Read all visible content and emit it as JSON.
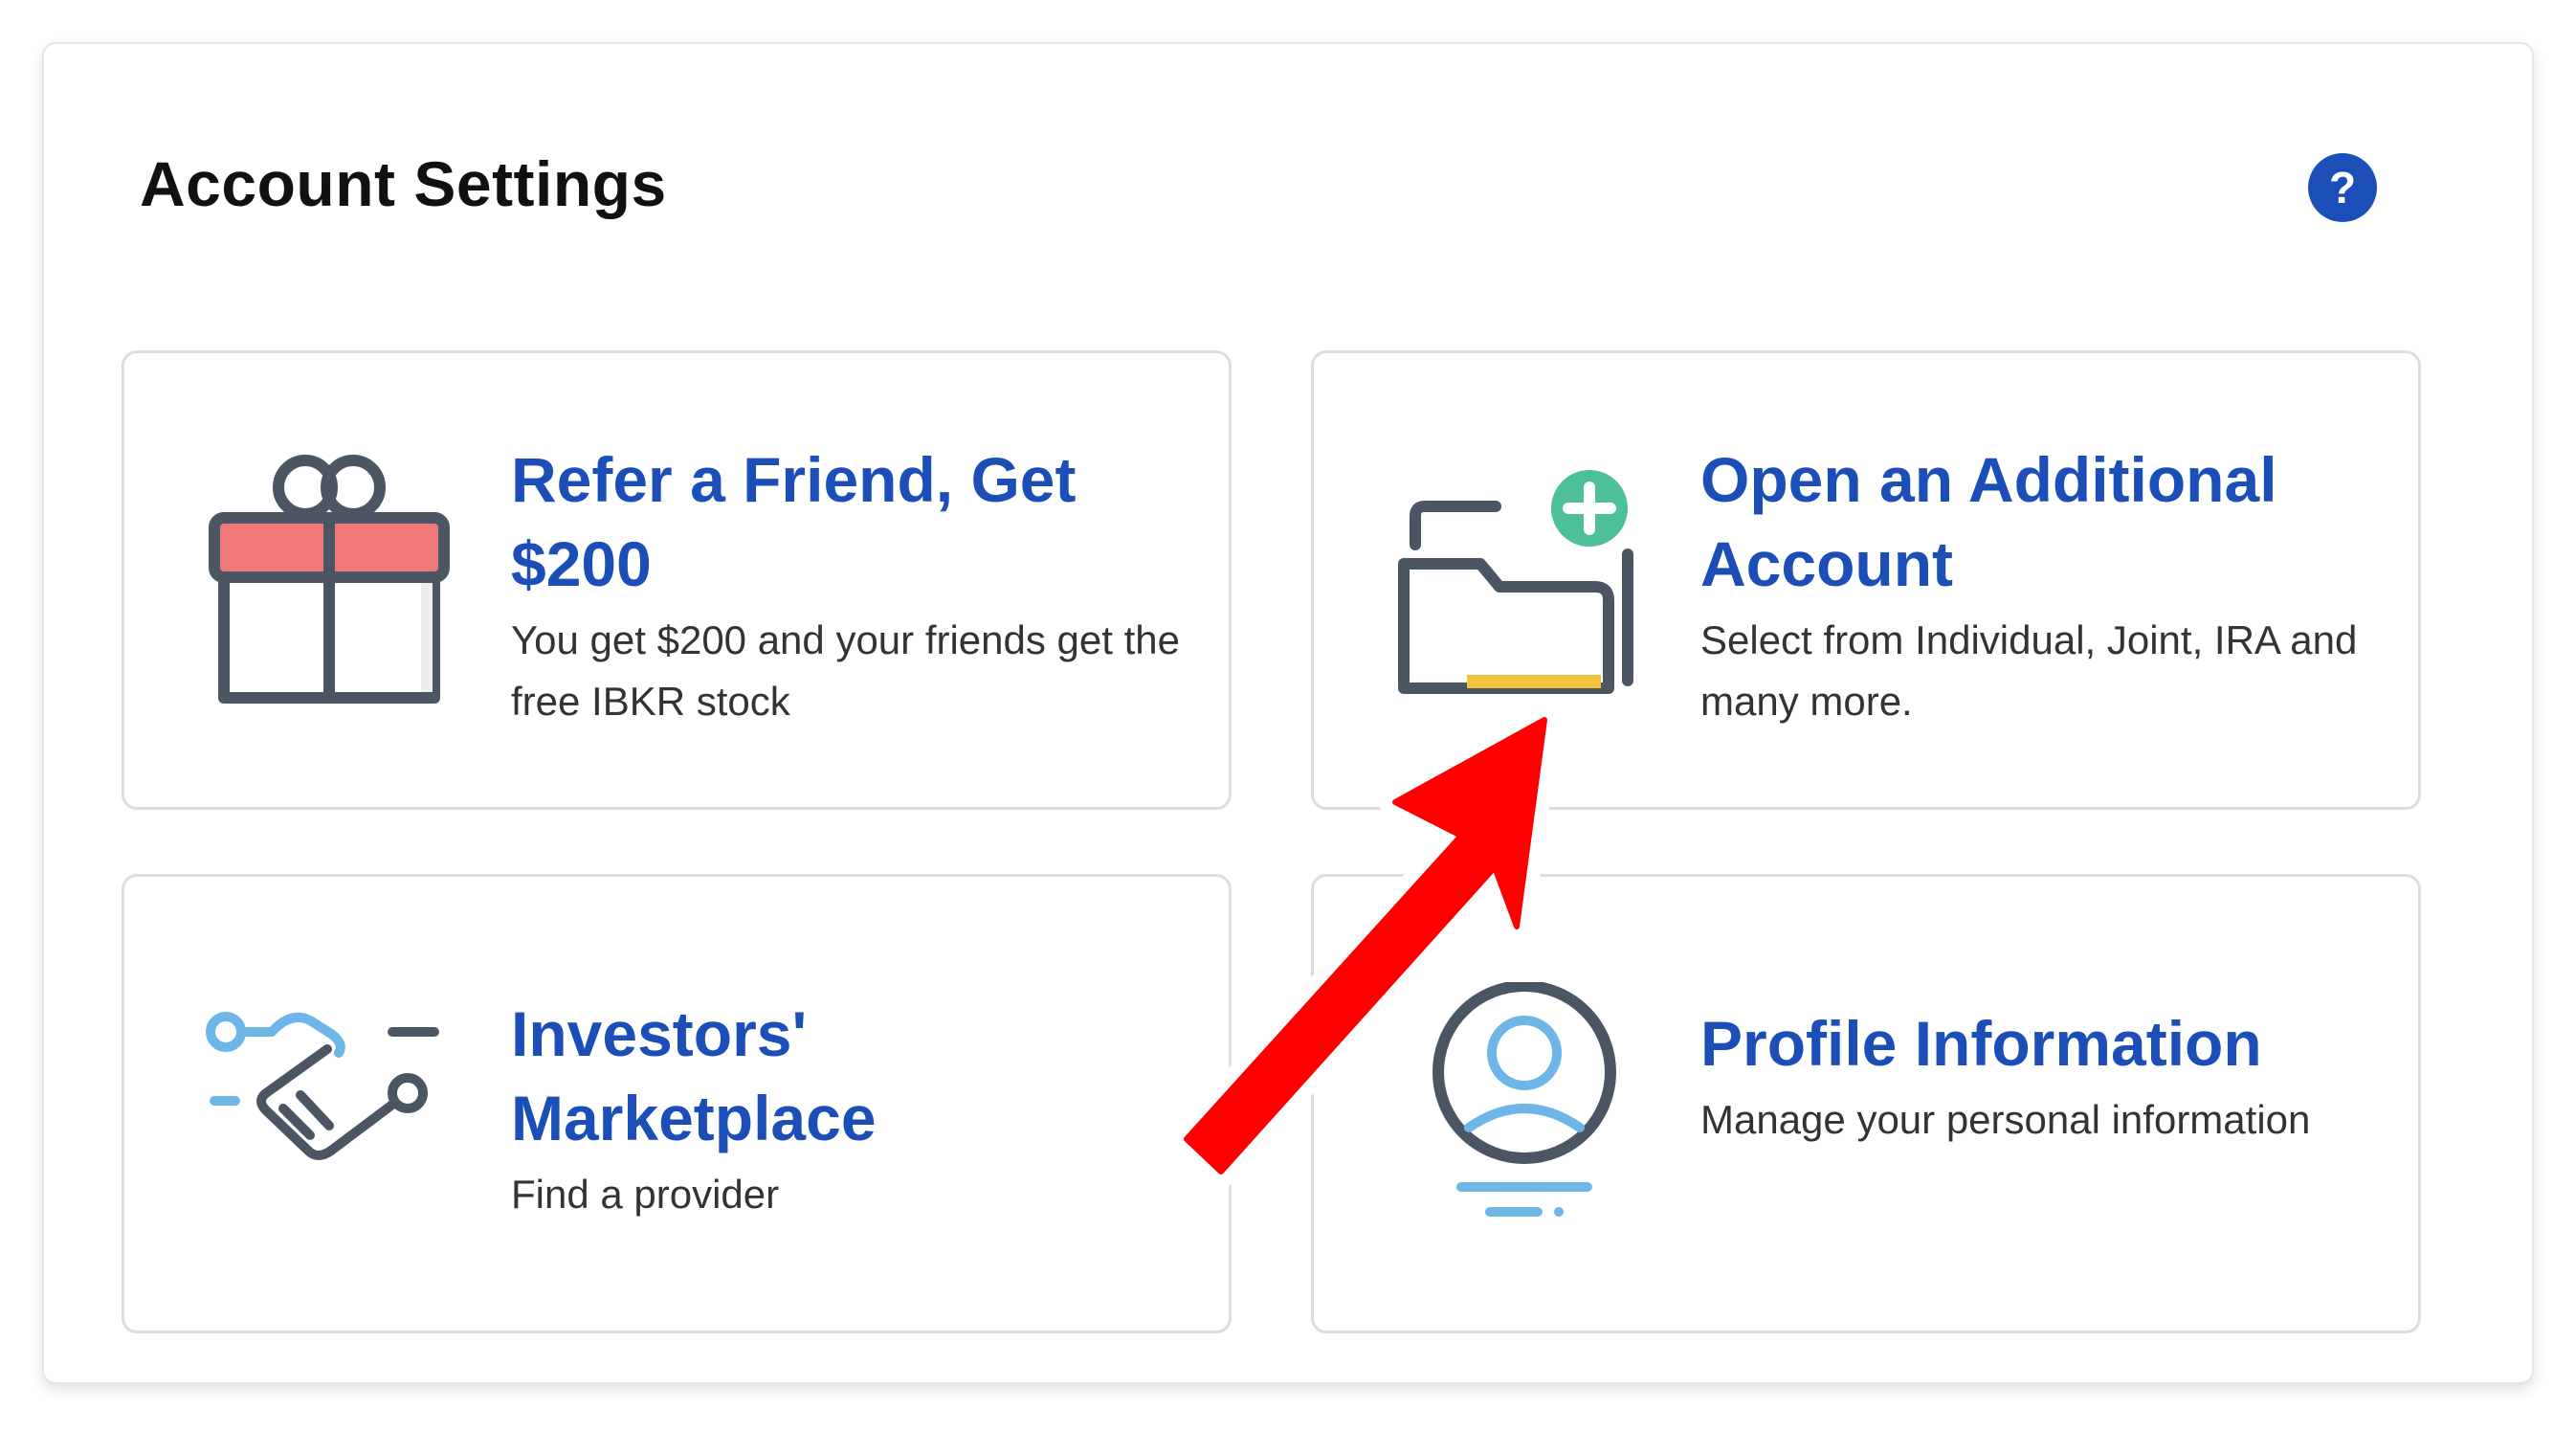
{
  "header": {
    "title": "Account Settings",
    "help_icon": "question-mark-icon",
    "help_label": "?"
  },
  "cards": [
    {
      "heading": "Refer a Friend, Get $200",
      "description": "You get $200 and your friends get the free IBKR stock",
      "icon": "gift-icon"
    },
    {
      "heading": "Open an Additional Account",
      "description": "Select from Individual, Joint, IRA and many more.",
      "icon": "folder-plus-icon"
    },
    {
      "heading": "Investors' Marketplace",
      "description": "Find a provider",
      "icon": "handshake-icon"
    },
    {
      "heading": "Profile Information",
      "description": "Manage your personal information",
      "icon": "user-profile-icon"
    }
  ],
  "colors": {
    "brand_blue": "#1b4fb7",
    "icon_gray": "#4b5563",
    "gift_red": "#f07a7a",
    "folder_yellow": "#f5c33b",
    "plus_green": "#4dbf9a",
    "light_blue": "#6fb6e8",
    "annotation_red": "#ff0000"
  },
  "annotation": {
    "type": "arrow",
    "points_to": "Open an Additional Account"
  }
}
